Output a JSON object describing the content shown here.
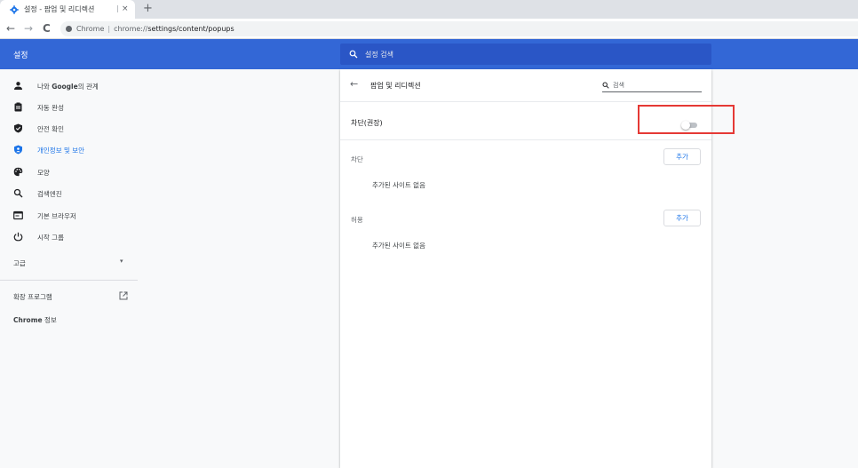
{
  "browser": {
    "tab_title": "설정 - 팝업 및 리디렉션",
    "tab_close": "×",
    "new_tab": "+",
    "nav_back": "←",
    "nav_forward": "→",
    "nav_reload": "C",
    "url_scheme_label": "Chrome",
    "url_separator": "|",
    "url_host": "chrome://",
    "url_path": "settings/content/popups"
  },
  "header": {
    "title": "설정",
    "search_placeholder": "설정 검색"
  },
  "sidebar": {
    "items": [
      {
        "label_prefix": "나와 ",
        "label_bold": "Google",
        "label_suffix": "의 관계",
        "icon": "person-icon"
      },
      {
        "label": "자동 완성",
        "icon": "clipboard-icon"
      },
      {
        "label": "안전 확인",
        "icon": "shield-check-icon"
      },
      {
        "label": "개인정보 및 보안",
        "icon": "shield-icon",
        "active": true
      },
      {
        "label": "모양",
        "icon": "palette-icon"
      },
      {
        "label": "검색엔진",
        "icon": "search-icon"
      },
      {
        "label": "기본 브라우저",
        "icon": "browser-window-icon"
      },
      {
        "label": "시작 그룹",
        "icon": "power-icon"
      }
    ],
    "advanced_label": "고급",
    "advanced_arrow": "▾",
    "extensions_label": "확장 프로그램",
    "about_bold": "Chrome",
    "about_suffix": " 정보"
  },
  "main": {
    "back": "←",
    "title": "팝업 및 리디렉션",
    "search_placeholder": "검색",
    "toggle_label": "차단(권장)",
    "toggle_on": false,
    "blocked_label": "차단",
    "blocked_add": "추가",
    "blocked_empty": "추가된 사이트 없음",
    "allowed_label": "허용",
    "allowed_add": "추가",
    "allowed_empty": "추가된 사이트 없음"
  },
  "colors": {
    "header_bg": "#3367d6",
    "accent": "#1a73e8",
    "highlight": "#e53935"
  }
}
